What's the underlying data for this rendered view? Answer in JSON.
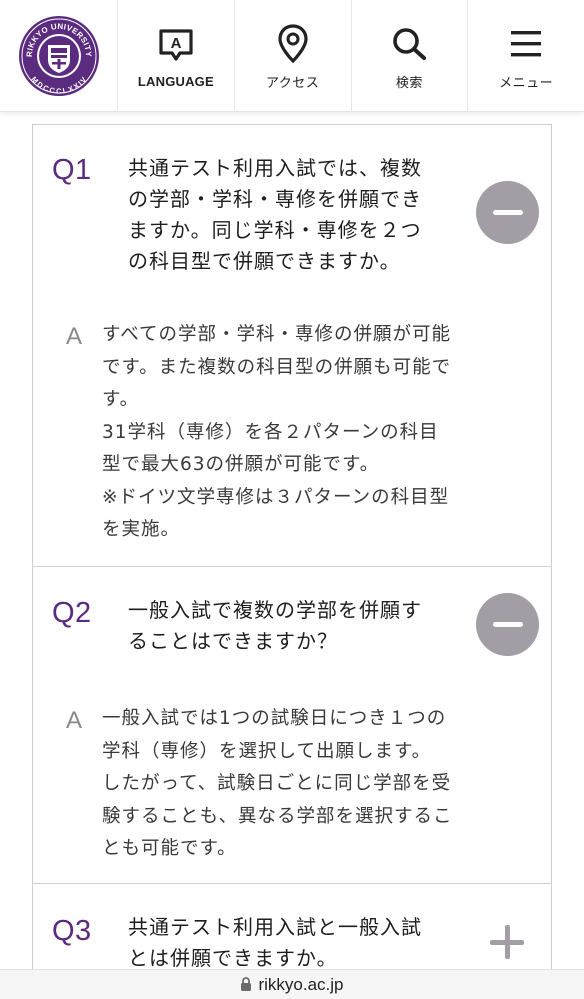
{
  "header": {
    "logo": {
      "ring_text_top": "RIKKYO UNIVERSITY",
      "ring_text_bottom": "MDCCCLXXIV",
      "brand_color": "#5a2b7f"
    },
    "nav": [
      {
        "label": "LANGUAGE",
        "icon": "language-icon"
      },
      {
        "label": "アクセス",
        "icon": "location-pin-icon"
      },
      {
        "label": "検索",
        "icon": "search-icon"
      },
      {
        "label": "メニュー",
        "icon": "menu-icon"
      }
    ]
  },
  "faq": [
    {
      "num": "Q1",
      "question_lines": [
        "共通テスト利用入試では、複数",
        "の学部・学科・専修を併願でき",
        "ますか。同じ学科・専修を２つ",
        "の科目型で併願できますか。"
      ],
      "expanded": true,
      "answer_mark": "A",
      "answer_lines": [
        "すべての学部・学科・専修の併願が可能",
        "です。また複数の科目型の併願も可能で",
        "す。",
        "31学科（専修）を各２パターンの科目",
        "型で最大63の併願が可能です。",
        "※ドイツ文学専修は３パターンの科目型",
        "を実施。"
      ]
    },
    {
      "num": "Q2",
      "question_lines": [
        "一般入試で複数の学部を併願す",
        "ることはできますか？"
      ],
      "expanded": true,
      "answer_mark": "A",
      "answer_lines": [
        "一般入試では1つの試験日につき１つの",
        "学科（専修）を選択して出願します。",
        "したがって、試験日ごとに同じ学部を受",
        "験することも、異なる学部を選択するこ",
        "とも可能です。"
      ]
    },
    {
      "num": "Q3",
      "question_lines": [
        "共通テスト利用入試と一般入試",
        "とは併願できますか。"
      ],
      "expanded": false
    }
  ],
  "colors": {
    "accent": "#5a2b7f",
    "toggle": "#a39da6",
    "border": "#cfcfcf"
  },
  "url_bar": {
    "url": "rikkyo.ac.jp",
    "icon": "lock-icon"
  }
}
